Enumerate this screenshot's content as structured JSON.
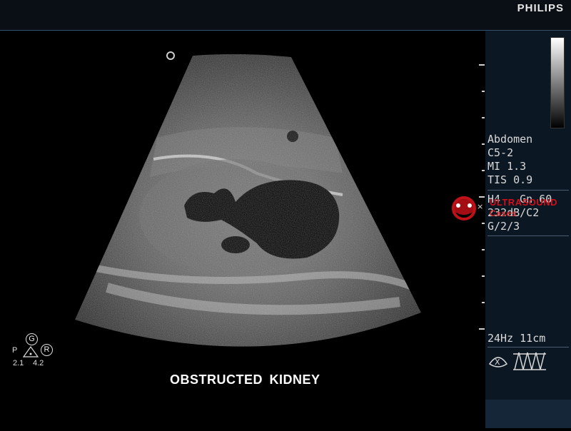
{
  "header": {
    "brand": "PHILIPS"
  },
  "scan_info": {
    "preset": "Abdomen",
    "transducer": "C5-2",
    "mi": "MI 1.3",
    "tis": "TIS 0.9",
    "harmonic_gain": "H4   Gn 60",
    "dynamic_range": "232dB/C2",
    "processing": "G/2/3",
    "frame_rate_depth": "24Hz 11cm"
  },
  "pgr_indicator": {
    "p": "P",
    "g": "G",
    "r": "R",
    "freq_low": "2.1",
    "freq_high": "4.2"
  },
  "caption": "OBSTRUCTED  KIDNEY",
  "watermark": {
    "text": "ULTRASOUND",
    "subtext": "Cases"
  },
  "icons": {
    "focus": "focus-marker-icon",
    "probe": "probe-orientation-icon",
    "array": "array-elements-icon"
  }
}
